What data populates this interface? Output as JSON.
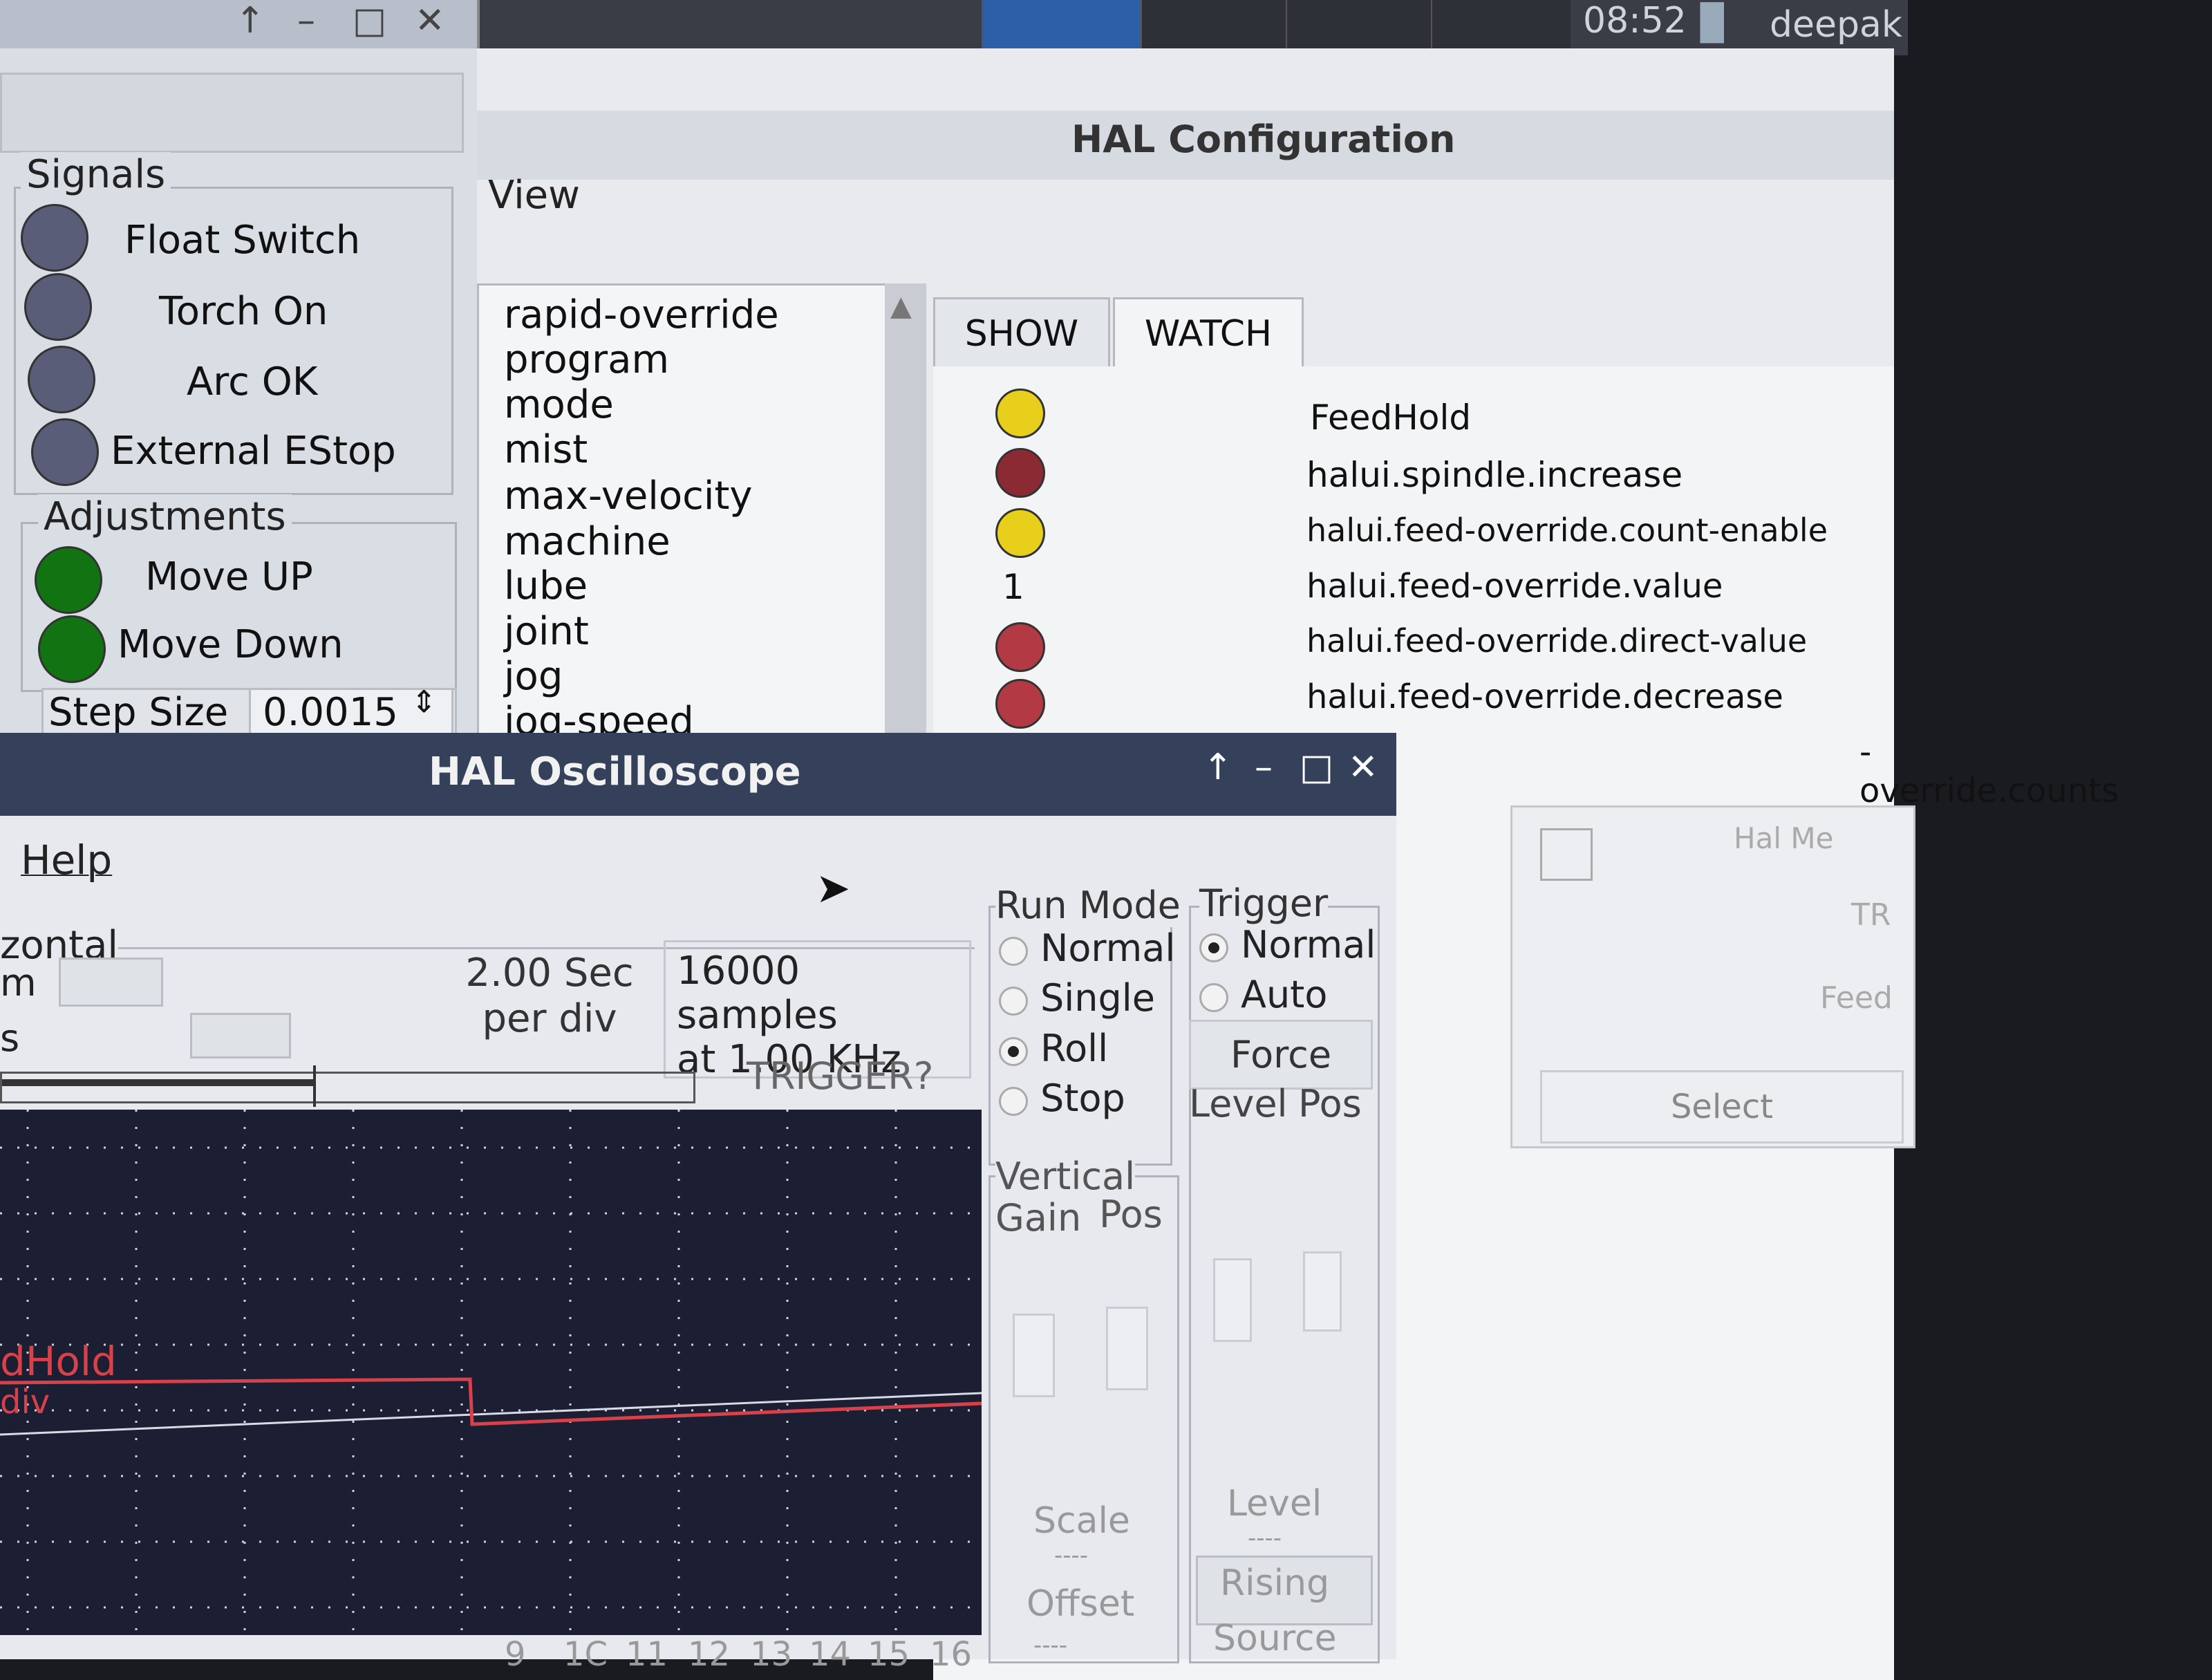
{
  "topbar": {
    "clock": "08:52",
    "user": "deepak"
  },
  "left_panel": {
    "signals_title": "Signals",
    "signals": [
      {
        "label": "Float Switch",
        "state": "off"
      },
      {
        "label": "Torch On",
        "state": "off"
      },
      {
        "label": "Arc OK",
        "state": "off"
      },
      {
        "label": "External EStop",
        "state": "off"
      }
    ],
    "adjustments_title": "Adjustments",
    "adjustments": [
      {
        "label": "Move UP",
        "state": "on"
      },
      {
        "label": "Move Down",
        "state": "on"
      }
    ],
    "step_size_label": "Step Size",
    "step_size_value": "0.0015"
  },
  "hal_config": {
    "title": "HAL Configuration",
    "menu_view": "View",
    "tree_items": [
      "rapid-override",
      "program",
      "mode",
      "mist",
      "max-velocity",
      "machine",
      "lube",
      "joint",
      "jog",
      "jog-speed"
    ],
    "tabs": {
      "show": "SHOW",
      "watch": "WATCH"
    },
    "watch_items": [
      {
        "indicator": "yellow",
        "label": "FeedHold"
      },
      {
        "indicator": "red",
        "label": "halui.spindle.increase"
      },
      {
        "indicator": "yellow",
        "label": "halui.feed-override.count-enable"
      },
      {
        "indicator": "value",
        "value": "1",
        "label": "halui.feed-override.value"
      },
      {
        "indicator": "red",
        "label": "halui.feed-override.direct-value"
      },
      {
        "indicator": "red",
        "label": "halui.feed-override.decrease"
      },
      {
        "indicator": "hidden",
        "label": "-override.counts"
      }
    ]
  },
  "hal_meter": {
    "title": "Hal Me",
    "tr": "TR",
    "feed": "Feed",
    "select": "Select"
  },
  "oscilloscope": {
    "title": "HAL Oscilloscope",
    "menu_help": "Help",
    "horizontal_label": "zontal",
    "zoom_label": "m",
    "pos_label": "s",
    "per_div_line1": "2.00 Sec",
    "per_div_line2": "per div",
    "samples_line1": "16000 samples",
    "samples_line2": "at 1.00 KHz",
    "trigger_status": "TRIGGER?",
    "run_mode": {
      "title": "Run Mode",
      "options": [
        "Normal",
        "Single",
        "Roll",
        "Stop"
      ],
      "selected": "Roll"
    },
    "trigger": {
      "title": "Trigger",
      "options": [
        "Normal",
        "Auto"
      ],
      "selected": "Normal",
      "force_label": "Force",
      "level_label": "Level",
      "pos_label": "Pos",
      "level_text": "Level",
      "level_dash": "----",
      "rising_text": "Rising",
      "source_text": "Source"
    },
    "vertical": {
      "title": "Vertical",
      "gain_label": "Gain",
      "pos_label": "Pos",
      "scale_text": "Scale",
      "scale_dash": "----",
      "offset_text": "Offset",
      "offset_dash": "----"
    },
    "trace_label_1": "dHold",
    "trace_label_2": "div",
    "trace_color": "#d9414a",
    "x_ticks": [
      "9",
      "1C",
      "11",
      "12",
      "13",
      "14",
      "15",
      "16"
    ]
  }
}
